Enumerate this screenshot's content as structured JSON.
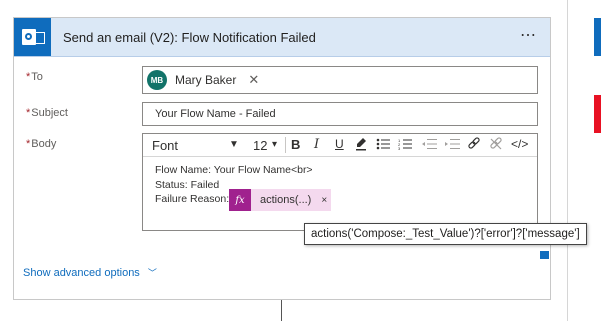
{
  "action": {
    "title": "Send an email (V2): Flow Notification Failed",
    "menu_icon": "⋯"
  },
  "fields": {
    "to": {
      "label": "To",
      "required_mark": "*",
      "recipient": {
        "initials": "MB",
        "name": "Mary Baker",
        "remove": "✕"
      }
    },
    "subject": {
      "label": "Subject",
      "required_mark": "*",
      "value": "Your Flow Name -  Failed"
    },
    "body": {
      "label": "Body",
      "required_mark": "*",
      "toolbar": {
        "font": "Font",
        "font_caret": "▼",
        "size": "12",
        "size_caret": "▾",
        "bold": "B",
        "italic": "I",
        "underline": "U",
        "code_view": "</>"
      },
      "lines": [
        "Flow Name: Your Flow Name<br>",
        "Status: Failed",
        "Failure Reason:"
      ],
      "token": {
        "icon": "fx",
        "text": "actions(...)",
        "remove": "×"
      }
    }
  },
  "tooltip": "actions('Compose:_Test_Value')?['error']?['message']",
  "show_advanced": {
    "label": "Show advanced options",
    "chevron": "﹀"
  },
  "colors": {
    "header_bg": "#dbe8f6",
    "outlook_blue": "#0f6cbd",
    "avatar": "#127369",
    "token_icon": "#a0218e",
    "token_bg": "#f4d9ee",
    "error_red": "#e81123"
  },
  "icons": [
    "outlook-icon",
    "more-options-icon",
    "remove-icon",
    "highlight-icon",
    "bullet-list-icon",
    "numbered-list-icon",
    "outdent-icon",
    "indent-icon",
    "link-icon",
    "unlink-icon",
    "code-view-icon",
    "expression-icon",
    "chevron-down-icon"
  ]
}
